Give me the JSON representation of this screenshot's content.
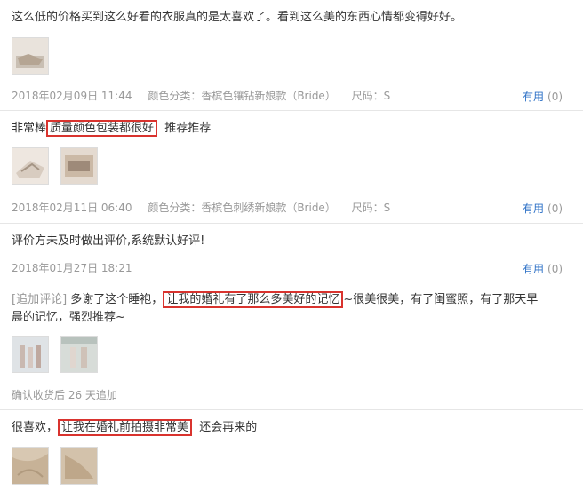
{
  "reviews": [
    {
      "text": "这么低的价格买到这么好看的衣服真的是太喜欢了。看到这么美的东西心情都变得好好。",
      "date": "2018年02月09日 11:44",
      "color": "颜色分类：香槟色镶钻新娘款（Bride）",
      "size": "尺码：S",
      "useful_label": "有用",
      "useful_count": "(0)"
    },
    {
      "text_pre": "非常棒",
      "text_highlight": "质量颜色包装都很好",
      "text_post": "推荐推荐",
      "date": "2018年02月11日 06:40",
      "color": "颜色分类：香槟色刺绣新娘款（Bride）",
      "size": "尺码：S",
      "useful_label": "有用",
      "useful_count": "(0)"
    },
    {
      "text": "评价方未及时做出评价,系统默认好评!",
      "date": "2018年01月27日 18:21",
      "useful_label": "有用",
      "useful_count": "(0)",
      "append_tag": "[追加评论]",
      "append_pre": "多谢了这个睡袍，",
      "append_highlight": "让我的婚礼有了那么多美好的记忆",
      "append_post": "~很美很美，有了闺蜜照，有了那天早",
      "append_line2": "晨的记忆，强烈推荐~",
      "append_meta": "确认收货后 26 天追加"
    },
    {
      "text_pre": "很喜欢，",
      "text_highlight": "让我在婚礼前拍摄非常美",
      "text_post": "还会再来的"
    }
  ]
}
